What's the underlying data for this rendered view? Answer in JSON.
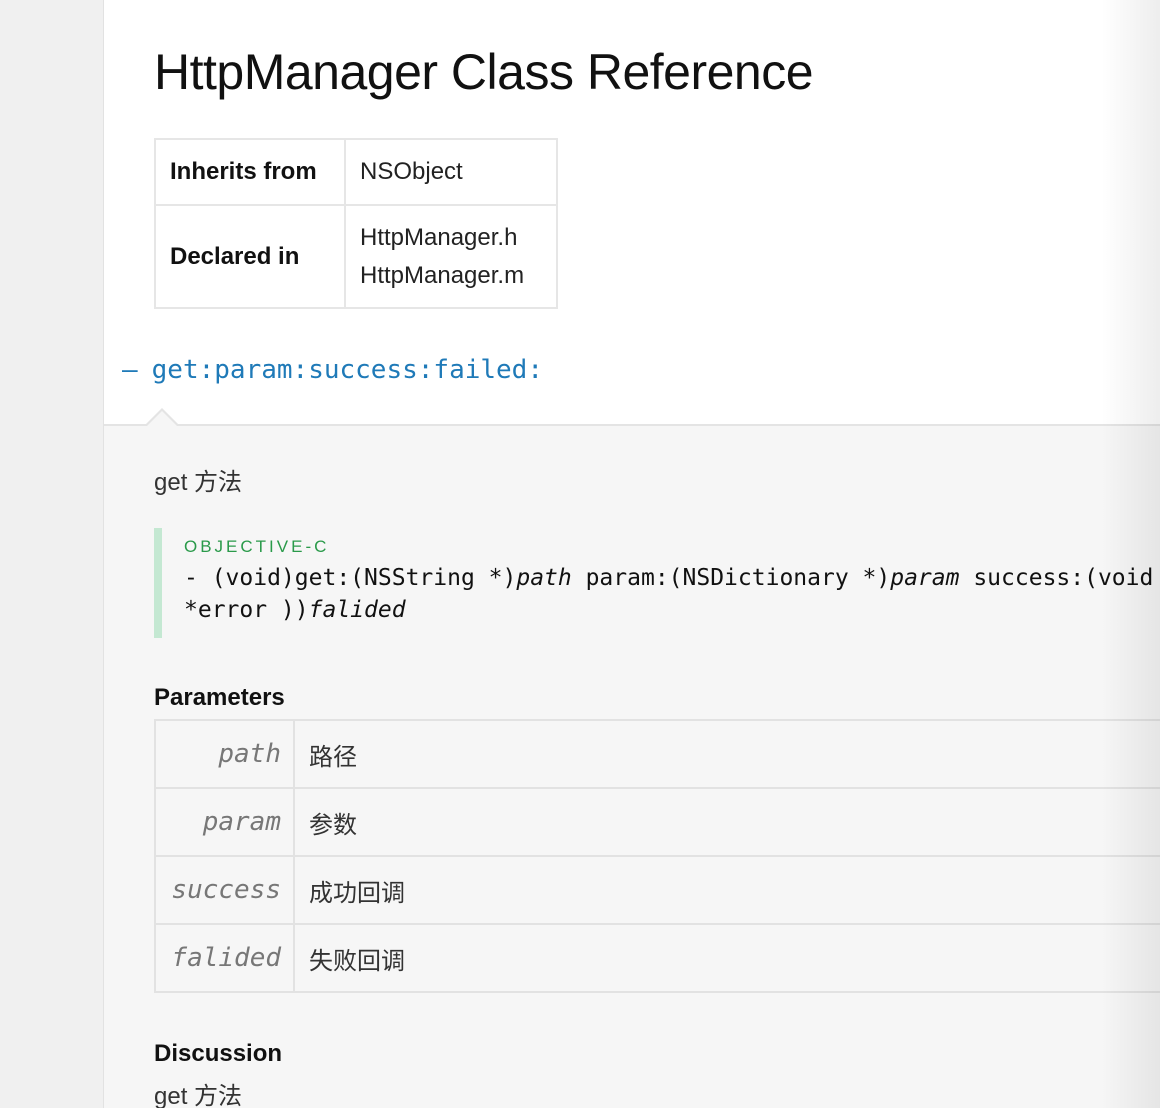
{
  "page": {
    "title": "HttpManager Class Reference"
  },
  "info_table": {
    "inherits_label": "Inherits from",
    "inherits_value": "NSObject",
    "declared_label": "Declared in",
    "declared_values": [
      "HttpManager.h",
      "HttpManager.m"
    ]
  },
  "method": {
    "prefix": "–",
    "name": "get:param:success:failed:",
    "abstract": "get 方法",
    "code": {
      "language": "OBJECTIVE-C",
      "line1": {
        "dash": "- ",
        "p1": "(void)get:(NSString *)",
        "v1": "path",
        "p2": " param:(NSDictionary *)",
        "v2": "param",
        "p3": " success:(void ("
      },
      "line2": {
        "p1": "*error ))",
        "v1": "falided"
      }
    },
    "parameters_title": "Parameters",
    "parameters": [
      {
        "name": "path",
        "desc": "路径"
      },
      {
        "name": "param",
        "desc": "参数"
      },
      {
        "name": "success",
        "desc": "成功回调"
      },
      {
        "name": "falided",
        "desc": "失败回调"
      }
    ],
    "discussion_title": "Discussion",
    "discussion": "get 方法"
  }
}
